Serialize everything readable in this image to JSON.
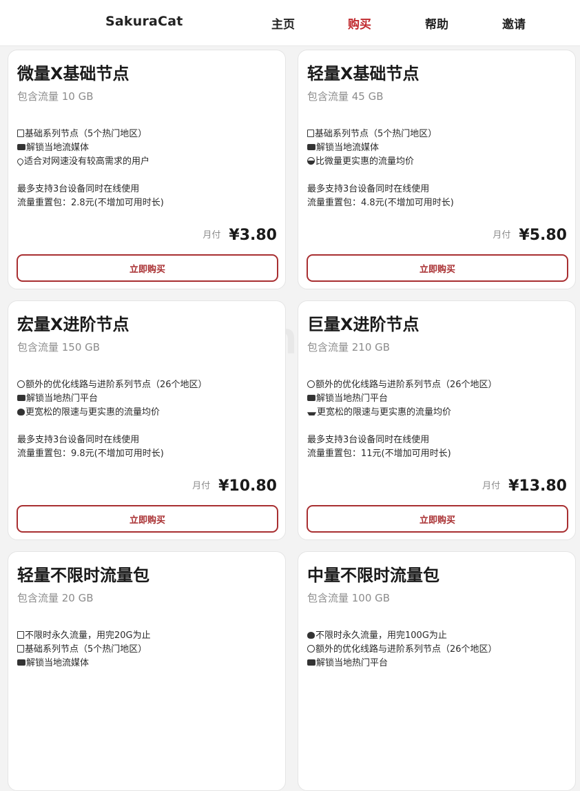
{
  "nav": {
    "brand": "SakuraCat",
    "items": [
      {
        "label": "主页",
        "active": false
      },
      {
        "label": "购买",
        "active": true
      },
      {
        "label": "帮助",
        "active": false
      },
      {
        "label": "邀请",
        "active": false
      }
    ]
  },
  "watermark": "FeijiChang.Org",
  "colors": {
    "accent": "#c0282d",
    "button_border": "#a82e30"
  },
  "plans": [
    {
      "title": "微量X基础节点",
      "traffic": "包含流量 10 GB",
      "features": [
        {
          "icon": "box-icon",
          "text": "基础系列节点（5个热门地区）"
        },
        {
          "icon": "camera-icon",
          "text": "解锁当地流媒体"
        },
        {
          "icon": "pin-icon",
          "text": "适合对网速没有较高需求的用户"
        }
      ],
      "notes": [
        "最多支持3台设备同时在线使用",
        "流量重置包：2.8元(不增加可用时长)"
      ],
      "period": "月付",
      "price": "¥3.80",
      "button": "立即购买"
    },
    {
      "title": "轻量X基础节点",
      "traffic": "包含流量 45 GB",
      "features": [
        {
          "icon": "box-icon",
          "text": "基础系列节点（5个热门地区）"
        },
        {
          "icon": "camera-icon",
          "text": "解锁当地流媒体"
        },
        {
          "icon": "bowl-icon",
          "text": "比微量更实惠的流量均价"
        }
      ],
      "notes": [
        "最多支持3台设备同时在线使用",
        "流量重置包：4.8元(不增加可用时长)"
      ],
      "period": "月付",
      "price": "¥5.80",
      "button": "立即购买"
    },
    {
      "title": "宏量X进阶节点",
      "traffic": "包含流量 150 GB",
      "features": [
        {
          "icon": "face-icon",
          "text": "额外的优化线路与进阶系列节点（26个地区）"
        },
        {
          "icon": "camera-icon",
          "text": "解锁当地热门平台"
        },
        {
          "icon": "brain-icon",
          "text": "更宽松的限速与更实惠的流量均价"
        }
      ],
      "notes": [
        "最多支持3台设备同时在线使用",
        "流量重置包：9.8元(不增加可用时长)"
      ],
      "period": "月付",
      "price": "¥10.80",
      "button": "立即购买"
    },
    {
      "title": "巨量X进阶节点",
      "traffic": "包含流量 210 GB",
      "features": [
        {
          "icon": "face-icon",
          "text": "额外的优化线路与进阶系列节点（26个地区）"
        },
        {
          "icon": "camera-icon",
          "text": "解锁当地热门平台"
        },
        {
          "icon": "ship-icon",
          "text": "更宽松的限速与更实惠的流量均价"
        }
      ],
      "notes": [
        "最多支持3台设备同时在线使用",
        "流量重置包：11元(不增加可用时长)"
      ],
      "period": "月付",
      "price": "¥13.80",
      "button": "立即购买"
    },
    {
      "title": "轻量不限时流量包",
      "traffic": "包含流量 20 GB",
      "features": [
        {
          "icon": "box-icon",
          "text": "不限时永久流量，用完20G为止"
        },
        {
          "icon": "box-icon",
          "text": "基础系列节点（5个热门地区）"
        },
        {
          "icon": "camera-icon",
          "text": "解锁当地流媒体"
        }
      ],
      "notes": [],
      "period": "",
      "price": "",
      "button": ""
    },
    {
      "title": "中量不限时流量包",
      "traffic": "包含流量 100 GB",
      "features": [
        {
          "icon": "brain-icon",
          "text": "不限时永久流量，用完100G为止"
        },
        {
          "icon": "face-icon",
          "text": "额外的优化线路与进阶系列节点（26个地区）"
        },
        {
          "icon": "camera-icon",
          "text": "解锁当地热门平台"
        }
      ],
      "notes": [],
      "period": "",
      "price": "",
      "button": ""
    }
  ]
}
